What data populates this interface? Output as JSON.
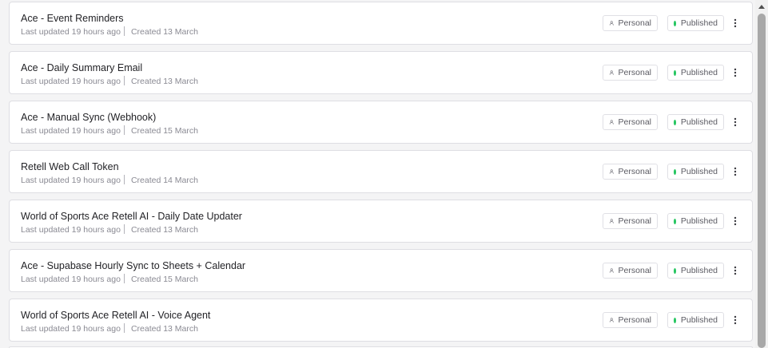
{
  "workflows": [
    {
      "title": "Ace - Event Reminders",
      "updated": "Last updated 19 hours ago",
      "created": "Created 13 March",
      "owner": "Personal",
      "status": "Published"
    },
    {
      "title": "Ace - Daily Summary Email",
      "updated": "Last updated 19 hours ago",
      "created": "Created 13 March",
      "owner": "Personal",
      "status": "Published"
    },
    {
      "title": "Ace - Manual Sync (Webhook)",
      "updated": "Last updated 19 hours ago",
      "created": "Created 15 March",
      "owner": "Personal",
      "status": "Published"
    },
    {
      "title": "Retell Web Call Token",
      "updated": "Last updated 19 hours ago",
      "created": "Created 14 March",
      "owner": "Personal",
      "status": "Published"
    },
    {
      "title": "World of Sports Ace Retell AI - Daily Date Updater",
      "updated": "Last updated 19 hours ago",
      "created": "Created 13 March",
      "owner": "Personal",
      "status": "Published"
    },
    {
      "title": "Ace - Supabase Hourly Sync to Sheets + Calendar",
      "updated": "Last updated 19 hours ago",
      "created": "Created 15 March",
      "owner": "Personal",
      "status": "Published"
    },
    {
      "title": "World of Sports Ace Retell AI - Voice Agent",
      "updated": "Last updated 19 hours ago",
      "created": "Created 13 March",
      "owner": "Personal",
      "status": "Published"
    }
  ],
  "colors": {
    "published_dot": "#22c55e",
    "text_primary": "#232327",
    "text_muted": "#8a8a93",
    "border": "#dedee3"
  },
  "icons": {
    "owner": "user-icon",
    "status": "status-dot-icon",
    "actions": "more-vertical-icon",
    "scroll_up": "scroll-up-arrow-icon"
  }
}
